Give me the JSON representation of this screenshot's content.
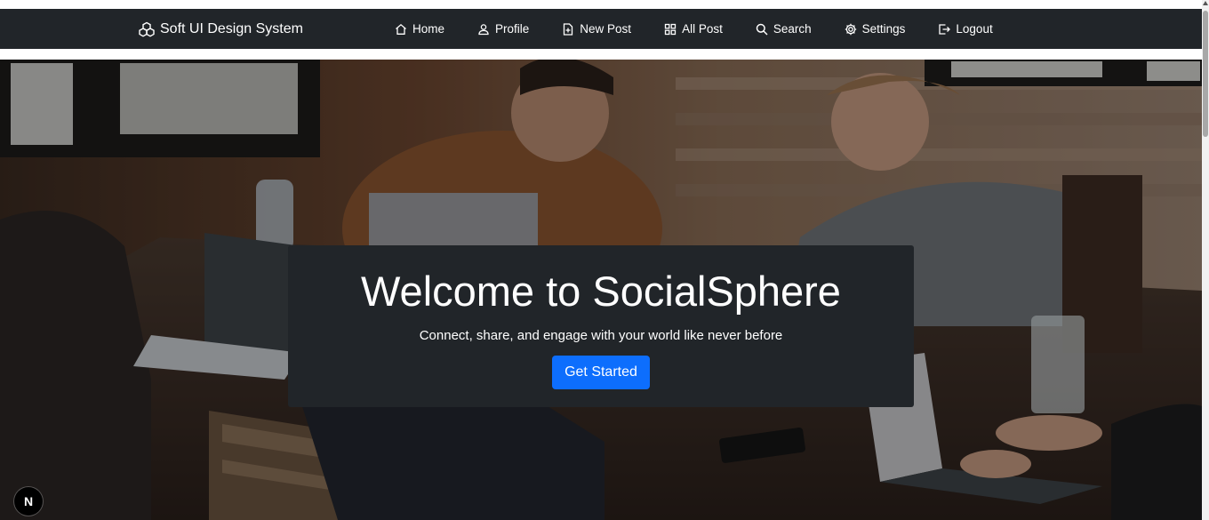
{
  "navbar": {
    "brand": "Soft UI Design System",
    "links": [
      {
        "label": "Home",
        "icon": "home-icon"
      },
      {
        "label": "Profile",
        "icon": "user-icon"
      },
      {
        "label": "New Post",
        "icon": "file-plus-icon"
      },
      {
        "label": "All Post",
        "icon": "grid-icon"
      },
      {
        "label": "Search",
        "icon": "search-icon"
      },
      {
        "label": "Settings",
        "icon": "gear-icon"
      },
      {
        "label": "Logout",
        "icon": "logout-icon"
      }
    ],
    "background": "#212529"
  },
  "hero": {
    "title": "Welcome to SocialSphere",
    "subtitle": "Connect, share, and engage with your world like never before",
    "cta_label": "Get Started",
    "cta_color": "#0d6efd",
    "card_background": "#212529"
  },
  "dev_badge": {
    "label": "N"
  }
}
